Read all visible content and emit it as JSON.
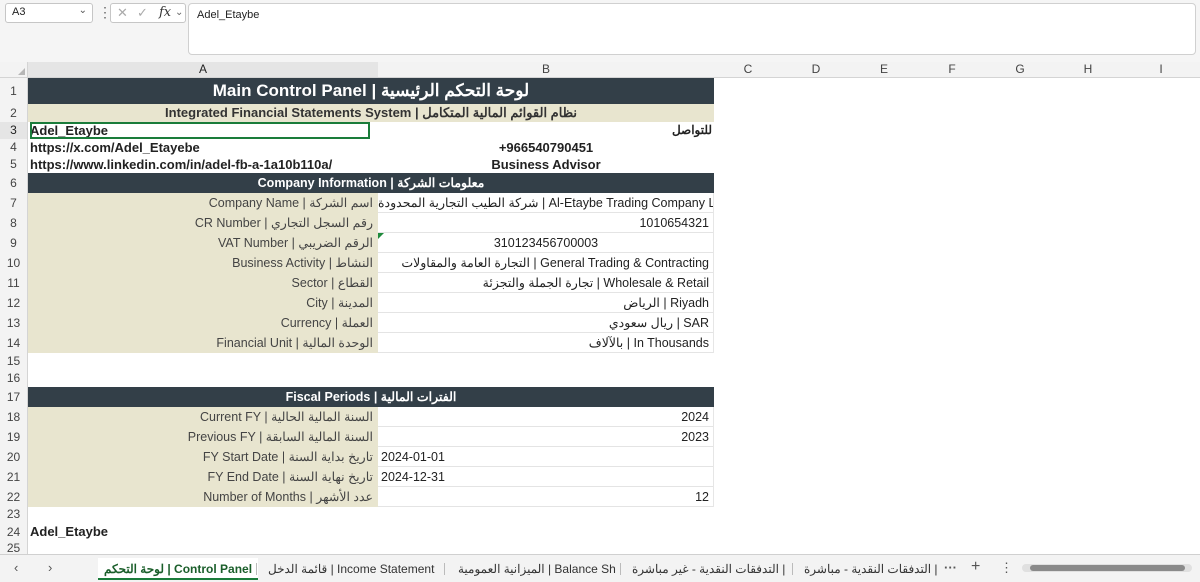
{
  "formula_bar": {
    "name_box": "A3",
    "fx": "fx",
    "value": "Adel_Etaybe"
  },
  "columns": [
    "A",
    "B",
    "C",
    "D",
    "E",
    "F",
    "G",
    "H",
    "I"
  ],
  "rows": [
    "1",
    "2",
    "3",
    "4",
    "5",
    "6",
    "7",
    "8",
    "9",
    "10",
    "11",
    "12",
    "13",
    "14",
    "15",
    "16",
    "17",
    "18",
    "19",
    "20",
    "21",
    "22",
    "23",
    "24",
    "25"
  ],
  "header": {
    "title": "Main Control Panel | لوحة التحكم الرئيسية",
    "subtitle": "Integrated Financial Statements System | نظام القوائم المالية المتكامل"
  },
  "contact": {
    "name": "Adel_Etaybe",
    "x_url": "https://x.com/Adel_Etayebe",
    "linkedin_url": "https://www.linkedin.com/in/adel-fb-a-1a10b110a/",
    "contact_label": "للتواصل",
    "phone": "+966540790451",
    "role": "Business Advisor"
  },
  "company": {
    "section_title": "Company Information | معلومات الشركة",
    "rows": [
      {
        "label": "Company Name | اسم الشركة",
        "value": "شركة الطيب التجارية المحدودة | Al-Etaybe Trading Company Ltd"
      },
      {
        "label": "CR Number | رقم السجل التجاري",
        "value": "1010654321"
      },
      {
        "label": "VAT Number | الرقم الضريبي",
        "value": "310123456700003"
      },
      {
        "label": "Business Activity | النشاط",
        "value": "التجارة العامة والمقاولات | General Trading & Contracting"
      },
      {
        "label": "Sector | القطاع",
        "value": "تجارة الجملة والتجزئة | Wholesale & Retail"
      },
      {
        "label": "City | المدينة",
        "value": "الرياض | Riyadh"
      },
      {
        "label": "Currency | العملة",
        "value": "ريال سعودي | SAR"
      },
      {
        "label": "Financial Unit | الوحدة المالية",
        "value": "بالآلاف | In Thousands"
      }
    ]
  },
  "fiscal": {
    "section_title": "Fiscal Periods | الفترات المالية",
    "rows": [
      {
        "label": "Current FY | السنة المالية الحالية",
        "value": "2024"
      },
      {
        "label": "Previous FY | السنة المالية السابقة",
        "value": "2023"
      },
      {
        "label": "FY Start Date | تاريخ بداية السنة",
        "value": "2024-01-01"
      },
      {
        "label": "FY End Date | تاريخ نهاية السنة",
        "value": "2024-12-31"
      },
      {
        "label": "Number of Months | عدد الأشهر",
        "value": "12"
      }
    ]
  },
  "footer_name": "Adel_Etaybe",
  "sheet_tabs": [
    {
      "label": "لوحة التحكم | Control Panel",
      "active": true
    },
    {
      "label": "قائمة الدخل | Income Statement",
      "active": false
    },
    {
      "label": "الميزانية العمومية | Balance Sh",
      "active": false
    },
    {
      "label": "التدفقات النقدية - غير مباشرة |",
      "active": false
    },
    {
      "label": "التدفقات النقدية - مباشرة |",
      "active": false
    }
  ],
  "tab_controls": {
    "more": "···",
    "add": "+",
    "menu": "⋮",
    "prev": "‹",
    "next": "›"
  }
}
